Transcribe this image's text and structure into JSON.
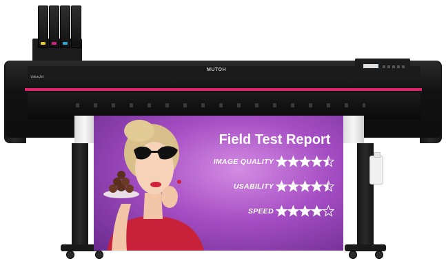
{
  "printer": {
    "brand": "MUTOH",
    "model_badge": "ValueJet",
    "ink_cap_colors": [
      "#e8d020",
      "#d0207c",
      "#2aa8d8",
      "#111111"
    ],
    "stripe_color": "#e0246c"
  },
  "poster": {
    "headline": "Field Test Report",
    "ratings": [
      {
        "label": "IMAGE QUALITY",
        "stars": 4.5,
        "max": 5
      },
      {
        "label": "USABILITY",
        "stars": 4.5,
        "max": 5
      },
      {
        "label": "SPEED",
        "stars": 4,
        "max": 5
      }
    ],
    "background_color": "#a54ec4"
  }
}
